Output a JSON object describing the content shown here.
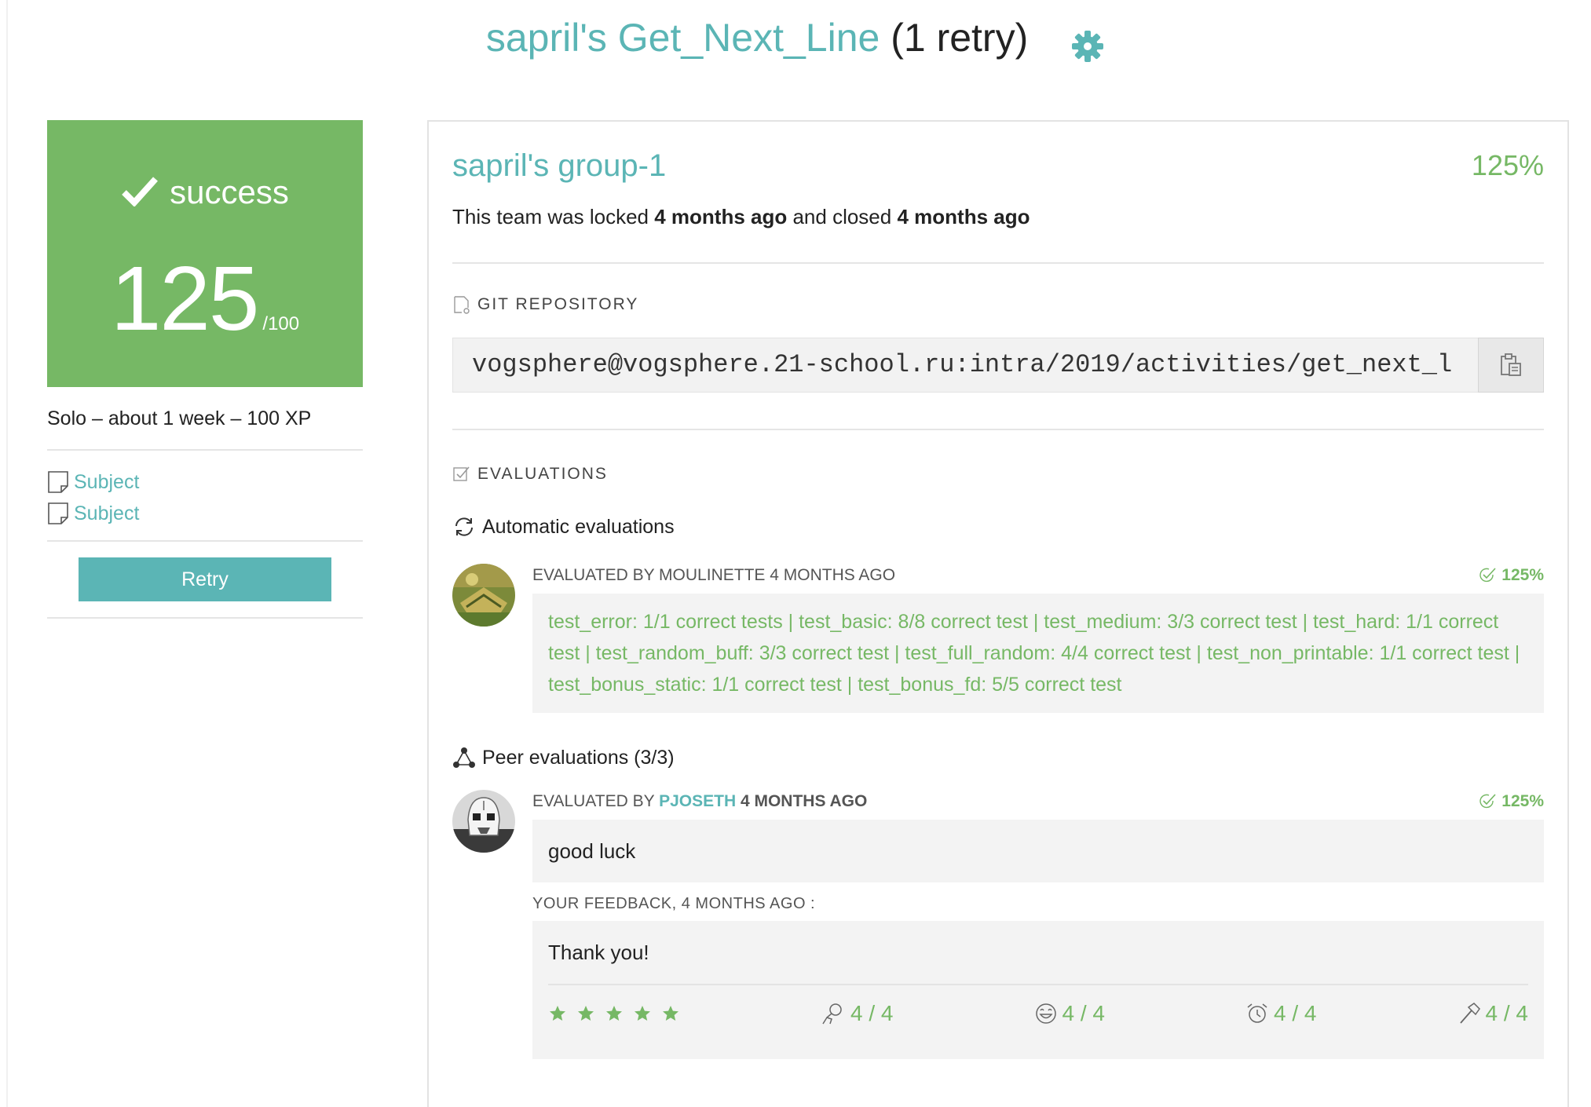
{
  "header": {
    "project_name": "sapril's Get_Next_Line",
    "retry_text": "(1 retry)",
    "settings_icon": "gear-icon"
  },
  "sidebar": {
    "status": "success",
    "mark": "125",
    "mark_max": "/100",
    "meta": "Solo – about 1 week – 100 XP",
    "subjects": [
      {
        "label": "Subject"
      },
      {
        "label": "Subject"
      }
    ],
    "retry_button": "Retry"
  },
  "team": {
    "name": "sapril's group-1",
    "final_mark": "125%",
    "status_prefix": "This team was locked",
    "locked_when": "4 months ago",
    "status_mid": "and closed",
    "closed_when": "4 months ago"
  },
  "git": {
    "label": "GIT REPOSITORY",
    "url": "vogsphere@vogsphere.21-school.ru:intra/2019/activities/get_next_l",
    "copy_icon": "clipboard-icon"
  },
  "evaluations": {
    "label": "EVALUATIONS",
    "automatic": {
      "heading": "Automatic evaluations",
      "evaluated_by": "EVALUATED BY MOULINETTE 4 MONTHS AGO",
      "score": "125%",
      "result": "test_error: 1/1 correct tests | test_basic: 8/8 correct test | test_medium: 3/3 correct test | test_hard: 1/1 correct test | test_random_buff: 3/3 correct test | test_full_random: 4/4 correct test | test_non_printable: 1/1 correct test | test_bonus_static: 1/1 correct test | test_bonus_fd: 5/5 correct test"
    },
    "peer": {
      "heading": "Peer evaluations (3/3)",
      "evaluated_by_prefix": "EVALUATED BY",
      "evaluator": "PJOSETH",
      "when": "4 MONTHS AGO",
      "score": "125%",
      "comment": "good luck",
      "feedback_label": "YOUR FEEDBACK, 4 MONTHS AGO :",
      "feedback": "Thank you!",
      "stars": 5,
      "ratings": [
        {
          "icon": "interested-icon",
          "value": "4 / 4"
        },
        {
          "icon": "smiley-icon",
          "value": "4 / 4"
        },
        {
          "icon": "alarm-clock-icon",
          "value": "4 / 4"
        },
        {
          "icon": "hammer-icon",
          "value": "4 / 4"
        }
      ]
    }
  },
  "colors": {
    "teal": "#5bb5b5",
    "green": "#76b865"
  }
}
